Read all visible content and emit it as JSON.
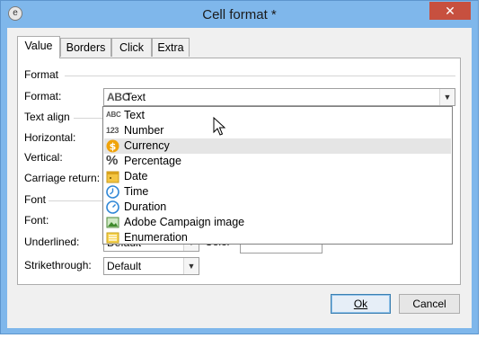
{
  "window": {
    "title": "Cell format *",
    "close_icon": "✕"
  },
  "tabs": [
    "Value",
    "Borders",
    "Click",
    "Extra"
  ],
  "groups": {
    "format": "Format",
    "text_align": "Text align",
    "font": "Font"
  },
  "fields": {
    "format_label": "Format:",
    "format_value": "Text",
    "format_prefix": "ABC",
    "horizontal_label": "Horizontal:",
    "vertical_label": "Vertical:",
    "carriage_return_label": "Carriage return:",
    "font_label": "Font:",
    "underlined_label": "Underlined:",
    "underlined_value": "Default",
    "color_label": "Color",
    "strikethrough_label": "Strikethrough:",
    "strikethrough_value": "Default"
  },
  "dropdown": {
    "items": [
      {
        "label": "Text",
        "icon": "abc-icon",
        "glyph": "ABC"
      },
      {
        "label": "Number",
        "icon": "number-icon",
        "glyph": "123"
      },
      {
        "label": "Currency",
        "icon": "currency-icon",
        "glyph": "$"
      },
      {
        "label": "Percentage",
        "icon": "percentage-icon",
        "glyph": "%"
      },
      {
        "label": "Date",
        "icon": "calendar-icon",
        "glyph": ""
      },
      {
        "label": "Time",
        "icon": "clock-icon",
        "glyph": ""
      },
      {
        "label": "Duration",
        "icon": "duration-icon",
        "glyph": ""
      },
      {
        "label": "Adobe Campaign image",
        "icon": "image-icon",
        "glyph": ""
      },
      {
        "label": "Enumeration",
        "icon": "list-icon",
        "glyph": ""
      }
    ],
    "hovered": "Currency"
  },
  "buttons": {
    "ok": "Ok",
    "cancel": "Cancel"
  },
  "colors": {
    "titlebar": "#7fb7eb",
    "close": "#c7503f",
    "accent": "#3c7fb1"
  }
}
